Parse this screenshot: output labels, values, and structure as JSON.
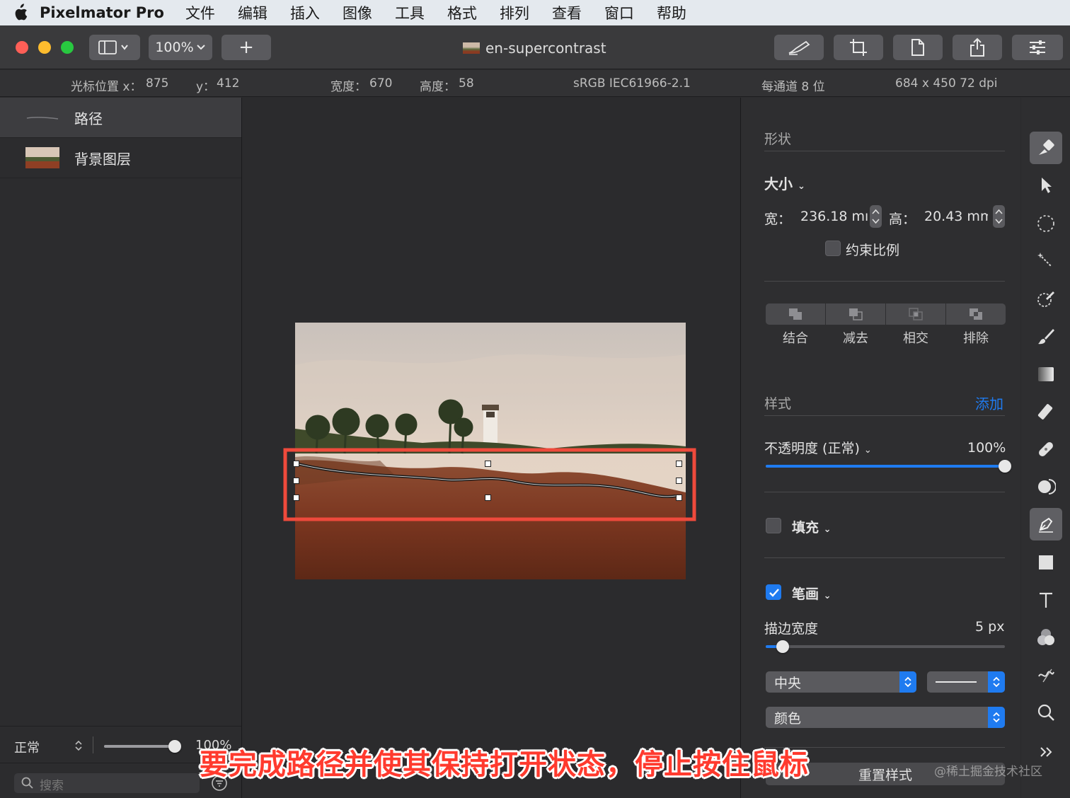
{
  "menubar": {
    "app_name": "Pixelmator Pro",
    "items": [
      "文件",
      "编辑",
      "插入",
      "图像",
      "工具",
      "格式",
      "排列",
      "查看",
      "窗口",
      "帮助"
    ]
  },
  "toolbar": {
    "zoom": "100%",
    "add_label": "+",
    "document_title": "en-supercontrast"
  },
  "infobar": {
    "cursor_x_label": "光标位置 x：",
    "cursor_x": "875",
    "cursor_y_label": "y：",
    "cursor_y": "412",
    "width_label": "宽度：",
    "width": "670",
    "height_label": "高度：",
    "height": "58",
    "color_profile": "sRGB IEC61966-2.1",
    "bit_depth": "每通道 8 位",
    "image_size": "684 x 450 72 dpi"
  },
  "layers": {
    "items": [
      {
        "name": "路径",
        "selected": true
      },
      {
        "name": "背景图层",
        "selected": false
      }
    ],
    "blend_mode": "正常",
    "opacity": "100%",
    "opacity_fraction": 1.0,
    "search_placeholder": "搜索"
  },
  "inspector": {
    "shape_title": "形状",
    "size_label": "大小",
    "width_label": "宽：",
    "width_value": "236.18 mı",
    "height_label": "高：",
    "height_value": "20.43 mm",
    "constrain_label": "约束比例",
    "constrain_checked": false,
    "boolean_ops": [
      "结合",
      "减去",
      "相交",
      "排除"
    ],
    "style_title": "样式",
    "add_label": "添加",
    "opacity_label": "不透明度 (正常)",
    "opacity_value": "100%",
    "opacity_fraction": 1.0,
    "fill_label": "填充",
    "fill_checked": false,
    "stroke_label": "笔画",
    "stroke_checked": true,
    "stroke_width_label": "描边宽度",
    "stroke_width_value": "5 px",
    "stroke_width_fraction": 0.07,
    "stroke_position": "中央",
    "stroke_type": "颜色",
    "reset_label": "重置样式"
  },
  "tools": [
    "style-tool",
    "arrange-tool",
    "selection-tool",
    "magic-wand-tool",
    "quick-select-tool",
    "paint-tool",
    "gradient-tool",
    "eraser-tool",
    "repair-tool",
    "retouch-tool",
    "pen-tool",
    "shape-tool",
    "type-tool",
    "color-adjust-tool",
    "distort-tool",
    "zoom-tool"
  ],
  "active_tool": "pen-tool",
  "colors": {
    "accent": "#1f7bf0",
    "highlight_box": "#ef4a3c",
    "caption": "#ff3a2e"
  },
  "caption": "要完成路径并使其保持打开状态，停止按住鼠标",
  "watermark": "@稀土掘金技术社区"
}
